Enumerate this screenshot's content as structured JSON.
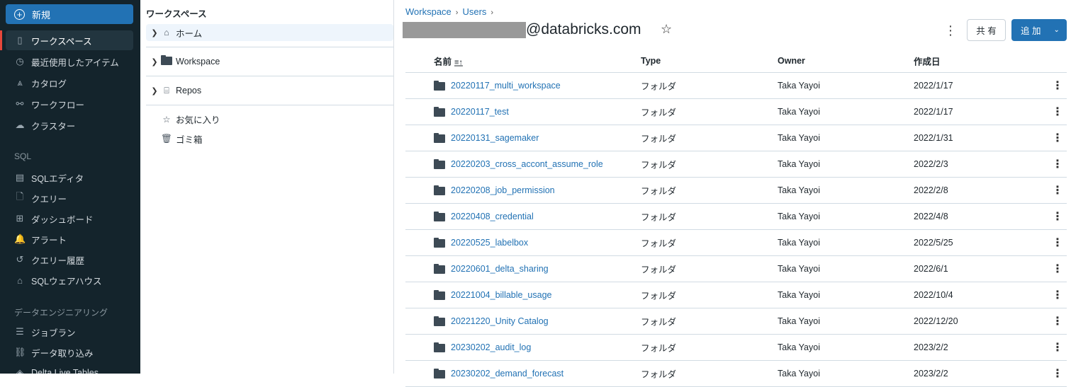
{
  "sidebar": {
    "new_label": "新規",
    "items": [
      {
        "label": "ワークスペース",
        "icon": "notebook-icon",
        "glyph": "▯"
      },
      {
        "label": "最近使用したアイテム",
        "icon": "clock-icon",
        "glyph": "◷"
      },
      {
        "label": "カタログ",
        "icon": "catalog-icon",
        "glyph": "⩓"
      },
      {
        "label": "ワークフロー",
        "icon": "workflow-icon",
        "glyph": "⚯"
      },
      {
        "label": "クラスター",
        "icon": "cloud-icon",
        "glyph": "☁"
      }
    ],
    "sql_label": "SQL",
    "sql_items": [
      {
        "label": "SQLエディタ",
        "icon": "editor-icon",
        "glyph": "▤"
      },
      {
        "label": "クエリー",
        "icon": "query-icon",
        "glyph": "🗋"
      },
      {
        "label": "ダッシュボード",
        "icon": "dashboard-icon",
        "glyph": "⊞"
      },
      {
        "label": "アラート",
        "icon": "bell-icon",
        "glyph": "🔔"
      },
      {
        "label": "クエリー履歴",
        "icon": "history-icon",
        "glyph": "↺"
      },
      {
        "label": "SQLウェアハウス",
        "icon": "warehouse-icon",
        "glyph": "⌂"
      }
    ],
    "de_label": "データエンジニアリング",
    "de_items": [
      {
        "label": "ジョブラン",
        "icon": "job-runs-icon",
        "glyph": "☰"
      },
      {
        "label": "データ取り込み",
        "icon": "ingest-icon",
        "glyph": "⛓"
      },
      {
        "label": "Delta Live Tables",
        "icon": "delta-icon",
        "glyph": "◈"
      }
    ]
  },
  "tree": {
    "title": "ワークスペース",
    "home": "ホーム",
    "workspace": "Workspace",
    "repos": "Repos",
    "favorites": "お気に入り",
    "trash": "ゴミ箱"
  },
  "main": {
    "breadcrumb": [
      "Workspace",
      "Users"
    ],
    "title": "@databricks.com",
    "share_label": "共 有",
    "add_label": "追 加",
    "columns": {
      "name": "名前",
      "type": "Type",
      "owner": "Owner",
      "date": "作成日"
    },
    "rows": [
      {
        "name": "20220117_multi_workspace",
        "type": "フォルダ",
        "owner": "Taka Yayoi",
        "date": "2022/1/17"
      },
      {
        "name": "20220117_test",
        "type": "フォルダ",
        "owner": "Taka Yayoi",
        "date": "2022/1/17"
      },
      {
        "name": "20220131_sagemaker",
        "type": "フォルダ",
        "owner": "Taka Yayoi",
        "date": "2022/1/31"
      },
      {
        "name": "20220203_cross_accont_assume_role",
        "type": "フォルダ",
        "owner": "Taka Yayoi",
        "date": "2022/2/3"
      },
      {
        "name": "20220208_job_permission",
        "type": "フォルダ",
        "owner": "Taka Yayoi",
        "date": "2022/2/8"
      },
      {
        "name": "20220408_credential",
        "type": "フォルダ",
        "owner": "Taka Yayoi",
        "date": "2022/4/8"
      },
      {
        "name": "20220525_labelbox",
        "type": "フォルダ",
        "owner": "Taka Yayoi",
        "date": "2022/5/25"
      },
      {
        "name": "20220601_delta_sharing",
        "type": "フォルダ",
        "owner": "Taka Yayoi",
        "date": "2022/6/1"
      },
      {
        "name": "20221004_billable_usage",
        "type": "フォルダ",
        "owner": "Taka Yayoi",
        "date": "2022/10/4"
      },
      {
        "name": "20221220_Unity Catalog",
        "type": "フォルダ",
        "owner": "Taka Yayoi",
        "date": "2022/12/20"
      },
      {
        "name": "20230202_audit_log",
        "type": "フォルダ",
        "owner": "Taka Yayoi",
        "date": "2023/2/2"
      },
      {
        "name": "20230202_demand_forecast",
        "type": "フォルダ",
        "owner": "Taka Yayoi",
        "date": "2023/2/2"
      }
    ]
  }
}
